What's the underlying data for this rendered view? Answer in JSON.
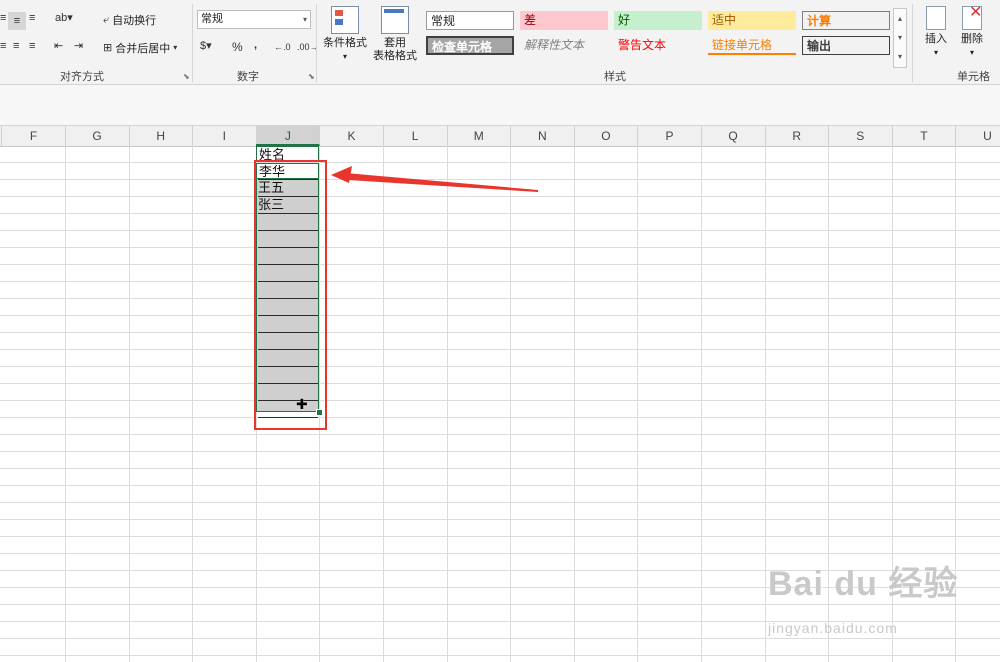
{
  "ribbon": {
    "alignment": {
      "wrap_text": "自动换行",
      "merge_center": "合并后居中",
      "group_label": "对齐方式"
    },
    "number": {
      "format_value": "常规",
      "percent": "%",
      "comma": ",",
      "inc_decimal": ".0←",
      "dec_decimal": ".00",
      "group_label": "数字"
    },
    "styles": {
      "conditional_format": "条件格式",
      "table_format_line1": "套用",
      "table_format_line2": "表格格式",
      "cells": [
        {
          "label": "常规"
        },
        {
          "label": "差"
        },
        {
          "label": "好"
        },
        {
          "label": "适中"
        },
        {
          "label": "计算"
        },
        {
          "label": "检查单元格"
        },
        {
          "label": "解释性文本"
        },
        {
          "label": "警告文本"
        },
        {
          "label": "链接单元格"
        },
        {
          "label": "输出"
        }
      ],
      "group_label": "样式"
    },
    "cells_group": {
      "insert": "插入",
      "delete": "删除",
      "group_label": "单元格"
    }
  },
  "columns": [
    "F",
    "G",
    "H",
    "I",
    "J",
    "K",
    "L",
    "M",
    "N",
    "O",
    "P",
    "Q",
    "R",
    "S",
    "T",
    "U"
  ],
  "selected_column": "J",
  "column_j_values": [
    "姓名",
    "李华",
    "王五",
    "张三"
  ],
  "watermark": {
    "brand": "Bai du 经验",
    "url": "jingyan.baidu.com"
  },
  "colors": {
    "selection_border": "#217346",
    "annotation_red": "#e8362d"
  }
}
